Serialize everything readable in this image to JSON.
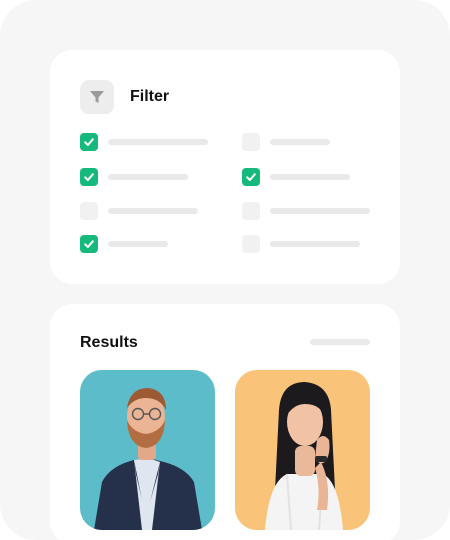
{
  "filter": {
    "title": "Filter",
    "icon": "funnel-icon",
    "options": [
      {
        "checked": true
      },
      {
        "checked": false
      },
      {
        "checked": true
      },
      {
        "checked": true
      },
      {
        "checked": false
      },
      {
        "checked": false
      },
      {
        "checked": true
      },
      {
        "checked": false
      }
    ]
  },
  "results": {
    "title": "Results",
    "items": [
      {
        "photo": "man-in-suit-photo"
      },
      {
        "photo": "woman-smiling-photo"
      }
    ]
  },
  "colors": {
    "accent": "#15b97c",
    "background": "#f6f6f6",
    "card": "#ffffff",
    "photo1_bg": "#5dbcc9",
    "photo2_bg": "#f9c47a"
  }
}
